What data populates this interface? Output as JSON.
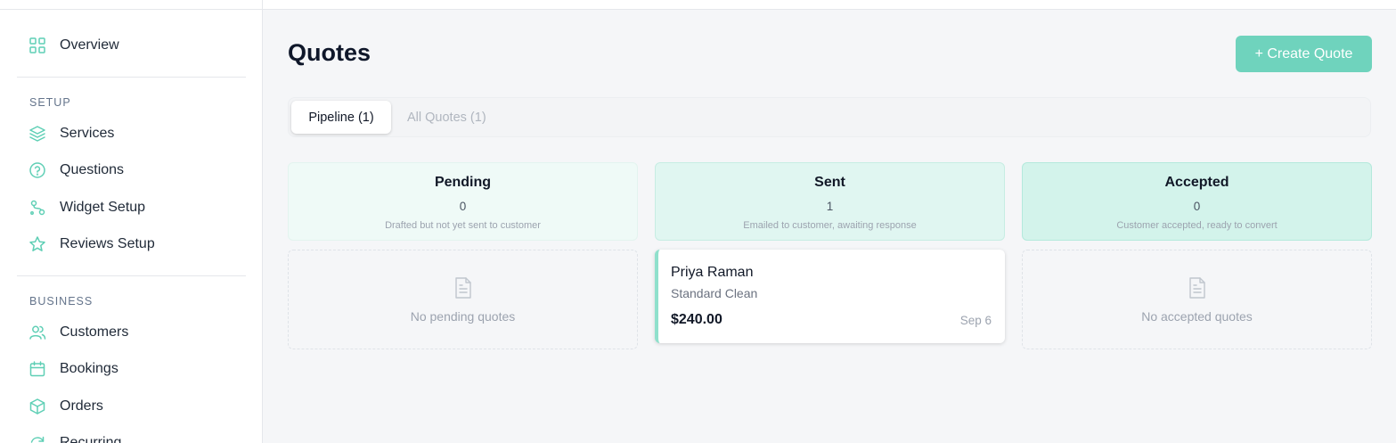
{
  "sidebar": {
    "overview": {
      "label": "Overview",
      "icon": "grid-icon"
    },
    "setup_section": "SETUP",
    "setup_items": [
      {
        "label": "Services",
        "icon": "layers-icon"
      },
      {
        "label": "Questions",
        "icon": "help-circle-icon"
      },
      {
        "label": "Widget Setup",
        "icon": "route-icon"
      },
      {
        "label": "Reviews Setup",
        "icon": "star-icon"
      }
    ],
    "business_section": "BUSINESS",
    "business_items": [
      {
        "label": "Customers",
        "icon": "users-icon"
      },
      {
        "label": "Bookings",
        "icon": "calendar-icon"
      },
      {
        "label": "Orders",
        "icon": "box-icon"
      },
      {
        "label": "Recurring",
        "icon": "refresh-icon"
      }
    ]
  },
  "header": {
    "title": "Quotes",
    "create_label": "+ Create Quote"
  },
  "tabs": {
    "pipeline": "Pipeline (1)",
    "all_quotes": "All Quotes (1)"
  },
  "columns": [
    {
      "title": "Pending",
      "count": "0",
      "description": "Drafted but not yet sent to customer",
      "empty_message": "No pending quotes",
      "color": "#effaf7"
    },
    {
      "title": "Sent",
      "count": "1",
      "description": "Emailed to customer, awaiting response",
      "color": "#e0f6f1"
    },
    {
      "title": "Accepted",
      "count": "0",
      "description": "Customer accepted, ready to convert",
      "empty_message": "No accepted quotes",
      "color": "#d3f3eb"
    }
  ],
  "quote_card": {
    "customer": "Priya Raman",
    "service": "Standard Clean",
    "amount": "$240.00",
    "date": "Sep 6"
  },
  "colors": {
    "accent": "#6fd3bd",
    "accent_border": "#8fe0cc"
  }
}
